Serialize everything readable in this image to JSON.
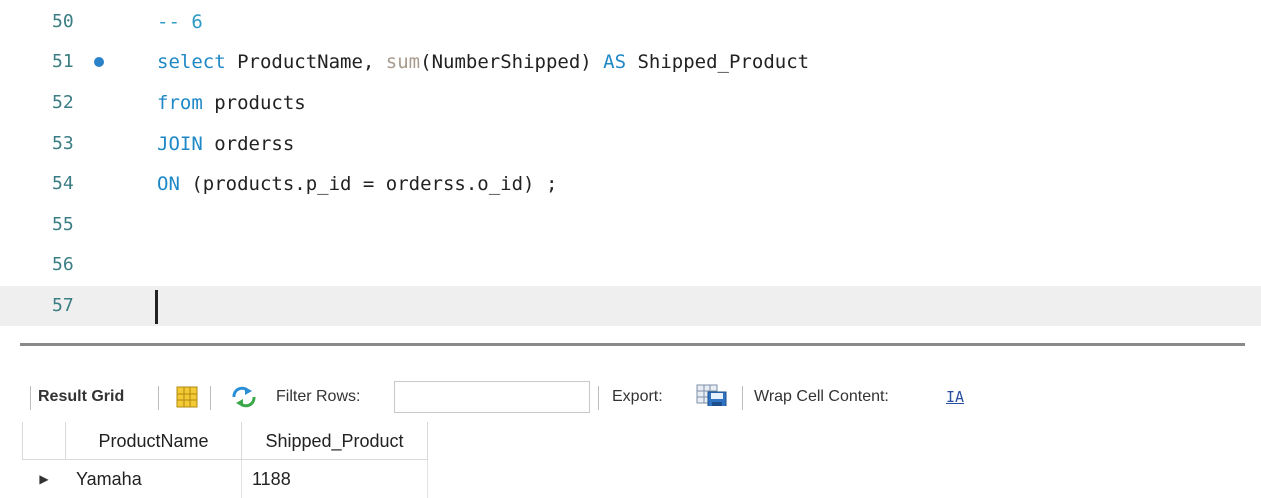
{
  "editor": {
    "lines": [
      {
        "number": "50",
        "segments": [
          {
            "text": "-- 6",
            "style": "cm"
          }
        ]
      },
      {
        "number": "51",
        "marker": true,
        "segments": [
          {
            "text": "select",
            "style": "kw"
          },
          {
            "text": " ProductName, ",
            "style": ""
          },
          {
            "text": "sum",
            "style": "fn"
          },
          {
            "text": "(NumberShipped) ",
            "style": ""
          },
          {
            "text": "AS",
            "style": "kw"
          },
          {
            "text": " Shipped_Product",
            "style": ""
          }
        ]
      },
      {
        "number": "52",
        "segments": [
          {
            "text": "from",
            "style": "kw"
          },
          {
            "text": " products",
            "style": ""
          }
        ]
      },
      {
        "number": "53",
        "segments": [
          {
            "text": "JOIN",
            "style": "kw"
          },
          {
            "text": " orderss",
            "style": ""
          }
        ]
      },
      {
        "number": "54",
        "segments": [
          {
            "text": "ON",
            "style": "kw"
          },
          {
            "text": " (products.p_id = orderss.o_id) ;",
            "style": ""
          }
        ]
      },
      {
        "number": "55",
        "segments": []
      },
      {
        "number": "56",
        "segments": []
      },
      {
        "number": "57",
        "current": true,
        "segments": []
      }
    ]
  },
  "toolbar": {
    "result_grid_label": "Result Grid",
    "filter_rows_label": "Filter Rows:",
    "filter_rows_value": "",
    "export_label": "Export:",
    "wrap_cell_label": "Wrap Cell Content:",
    "wrap_icon_text": "IA"
  },
  "grid": {
    "columns": [
      "ProductName",
      "Shipped_Product"
    ],
    "rows": [
      [
        "Yamaha",
        "1188"
      ]
    ]
  },
  "colors": {
    "keyword": "#1e88c7",
    "function": "#a89a8c",
    "comment": "#2d9bc4",
    "line_number": "#3a7d84",
    "marker": "#2a83c8"
  }
}
